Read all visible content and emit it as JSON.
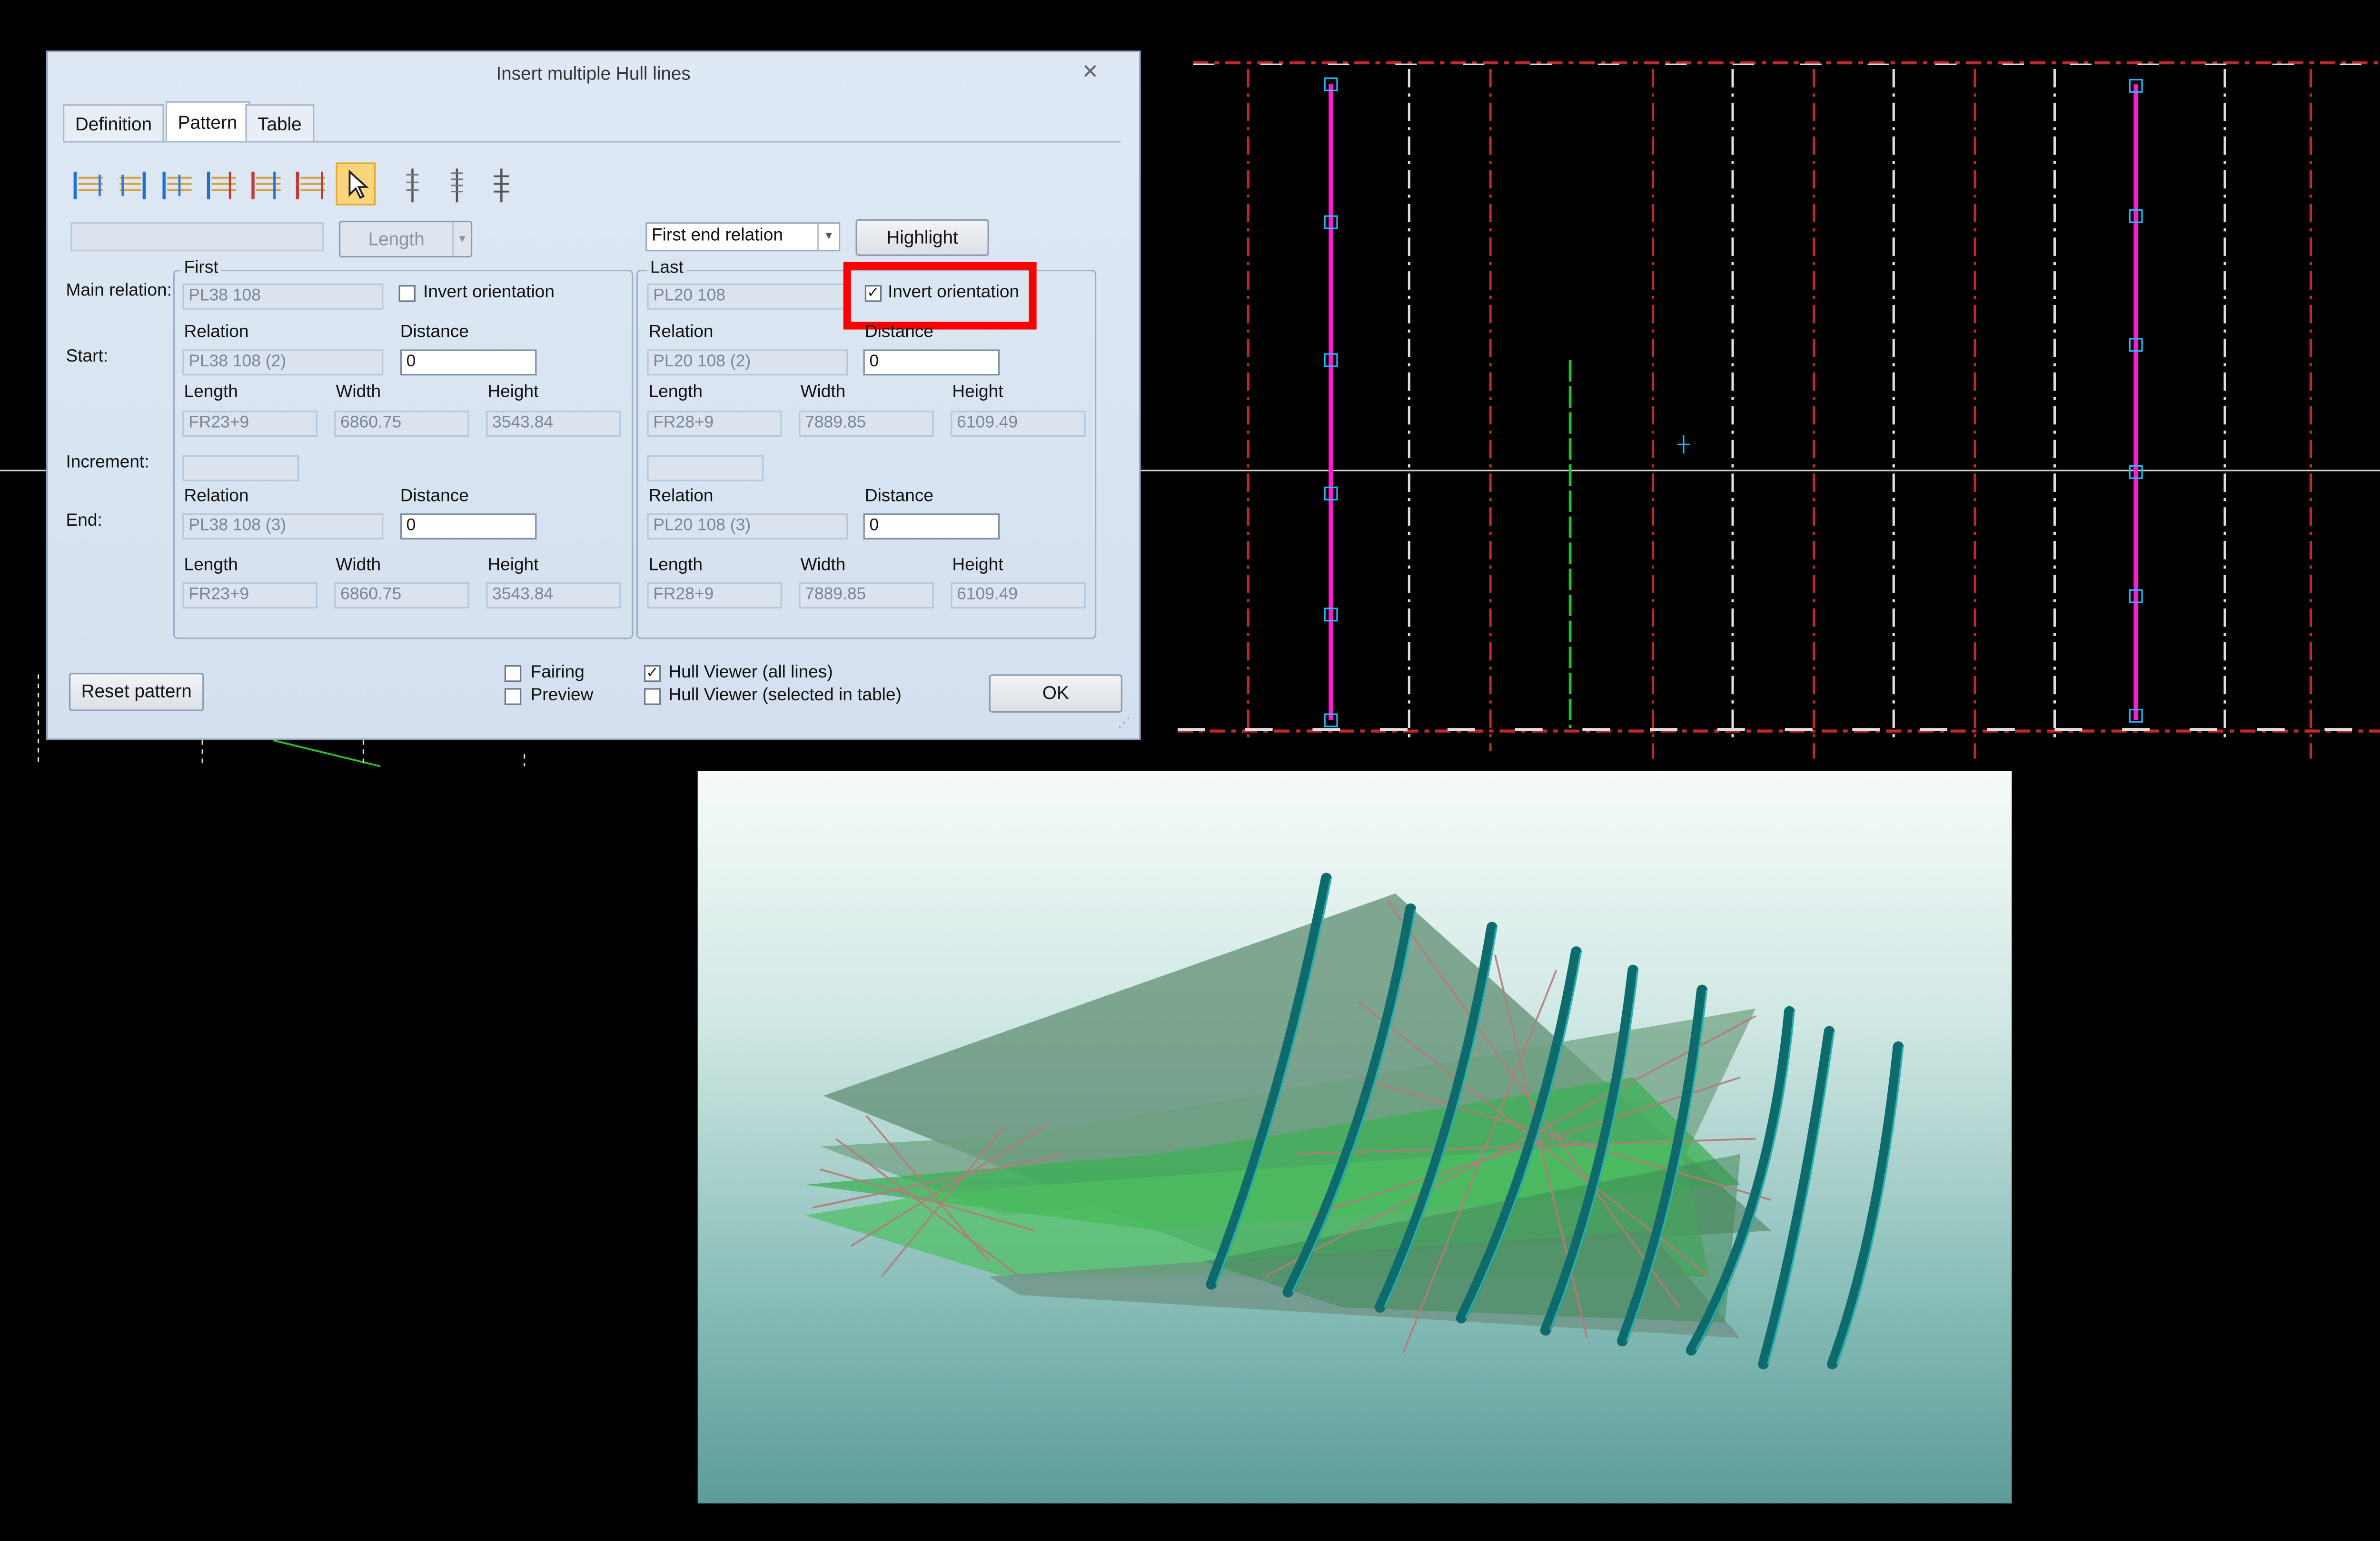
{
  "dialog": {
    "title": "Insert multiple Hull lines",
    "tabs": [
      "Definition",
      "Pattern",
      "Table"
    ],
    "active_tab": "Pattern",
    "toolbar_icons": [
      "pattern-tool-1-icon",
      "pattern-tool-2-icon",
      "pattern-tool-3-icon",
      "pattern-tool-4-icon",
      "pattern-tool-5-icon",
      "pattern-tool-6-icon",
      "select-arrow-icon",
      "distribute-1-icon",
      "distribute-2-icon",
      "distribute-3-icon"
    ],
    "name_field": "",
    "length_button": "Length",
    "end_relation": {
      "selected": "First end relation"
    },
    "highlight_button": "Highlight",
    "row_labels": {
      "main_relation": "Main relation:",
      "start": "Start:",
      "increment": "Increment:",
      "end": "End:"
    },
    "first": {
      "group_label": "First",
      "main_relation": "PL38 108",
      "invert_orientation_label": "Invert orientation",
      "invert_orientation_checked": false,
      "start": {
        "relation_label": "Relation",
        "relation": "PL38 108 (2)",
        "distance_label": "Distance",
        "distance": "0",
        "length_label": "Length",
        "length": "FR23+9",
        "width_label": "Width",
        "width": "6860.75",
        "height_label": "Height",
        "height": "3543.84"
      },
      "increment": "",
      "end": {
        "relation_label": "Relation",
        "relation": "PL38 108 (3)",
        "distance_label": "Distance",
        "distance": "0",
        "length_label": "Length",
        "length": "FR23+9",
        "width_label": "Width",
        "width": "6860.75",
        "height_label": "Height",
        "height": "3543.84"
      }
    },
    "last": {
      "group_label": "Last",
      "main_relation": "PL20 108",
      "invert_orientation_label": "Invert orientation",
      "invert_orientation_checked": true,
      "start": {
        "relation_label": "Relation",
        "relation": "PL20 108 (2)",
        "distance_label": "Distance",
        "distance": "0",
        "length_label": "Length",
        "length": "FR28+9",
        "width_label": "Width",
        "width": "7889.85",
        "height_label": "Height",
        "height": "6109.49"
      },
      "increment": "",
      "end": {
        "relation_label": "Relation",
        "relation": "PL20 108 (3)",
        "distance_label": "Distance",
        "distance": "0",
        "length_label": "Length",
        "length": "FR28+9",
        "width_label": "Width",
        "width": "7889.85",
        "height_label": "Height",
        "height": "6109.49"
      }
    },
    "reset_button": "Reset pattern",
    "checkboxes": {
      "fairing": {
        "label": "Fairing",
        "checked": false
      },
      "preview": {
        "label": "Preview",
        "checked": false
      },
      "hull_viewer_all": {
        "label": "Hull Viewer (all lines)",
        "checked": true
      },
      "hull_viewer_selected": {
        "label": "Hull Viewer (selected in table)",
        "checked": false
      }
    },
    "ok_button": "OK",
    "close_icon": "close-icon"
  },
  "colors": {
    "highlight": "#ff0000",
    "selected_line": "#ff1ccf",
    "green_line": "#22c22a",
    "frame_red": "#c0282b",
    "viewer_rib": "#0f6b6b"
  },
  "check_glyph": "✓"
}
